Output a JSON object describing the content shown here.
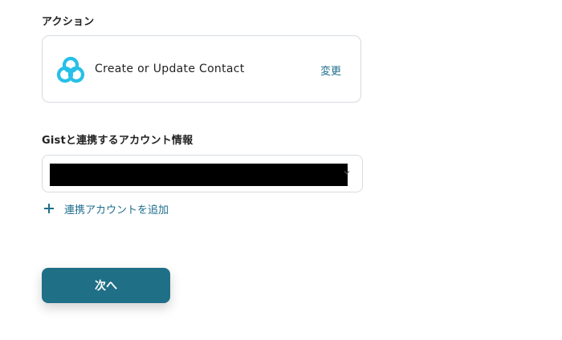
{
  "action_section": {
    "label": "アクション",
    "card": {
      "app_icon": "gist-logo-icon",
      "title": "Create or Update Contact",
      "change_label": "変更"
    }
  },
  "account_section": {
    "label": "Gistと連携するアカウント情報",
    "select": {
      "value": "",
      "redacted": true
    },
    "add_account_label": "連携アカウントを追加"
  },
  "footer": {
    "next_label": "次へ"
  },
  "colors": {
    "accent": "#1f6f86",
    "link": "#1f6e8c",
    "logo": "#26c0e8",
    "border": "#d7dbe0"
  }
}
